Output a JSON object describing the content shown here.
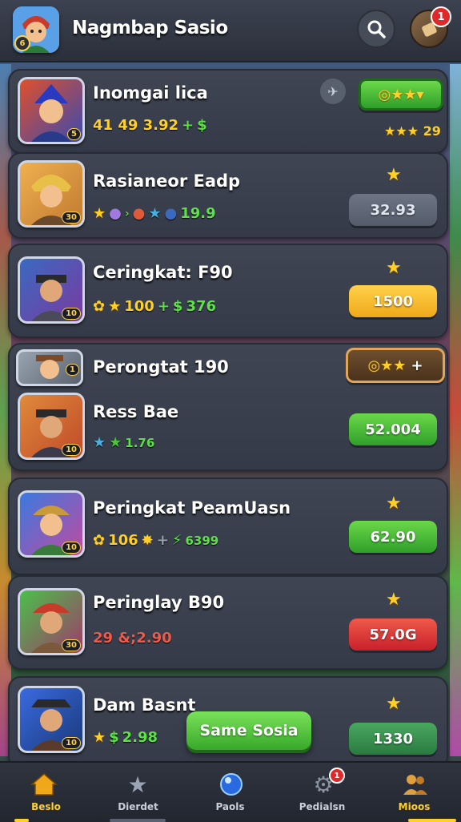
{
  "header": {
    "title": "Nagmbap Sasio",
    "avatar_badge": "6",
    "notification_count": "1"
  },
  "cards": [
    {
      "name": "Inomgai lica",
      "stat_a": "41 49 3.92",
      "stat_plus": "+",
      "stat_b": "$",
      "side_text": "29",
      "level": "5"
    },
    {
      "name": "Rasianeor Eadp",
      "stat_a": "",
      "stat_b": "19.9",
      "button": "32.93",
      "level": "30"
    },
    {
      "name": "Ceringkat: F90",
      "stat_a": "100",
      "stat_plus": "+",
      "stat_b": "376",
      "button": "1500",
      "level": "10"
    },
    {
      "name": "Perongtat 190",
      "level": "1",
      "button_plus": "+"
    },
    {
      "name": "Ress Bae",
      "stat_b": "1.76",
      "button": "52.004",
      "level": "10"
    },
    {
      "name": "Peringkat PeamUasn",
      "stat_a": "106",
      "stat_plus": "+",
      "stat_b": "6399",
      "button": "62.90",
      "level": "10"
    },
    {
      "name": "Peringlay B90",
      "stat_a": "29 &;2.90",
      "button": "57.0G",
      "level": "30"
    },
    {
      "name": "Dam Basnt",
      "stat_a": "2.98",
      "button": "1330",
      "level": "10"
    }
  ],
  "fab_label": "Same Sosia",
  "nav": [
    {
      "label": "Beslo",
      "icon": "home-icon",
      "active": true
    },
    {
      "label": "Dierdet",
      "icon": "star-icon",
      "active": false
    },
    {
      "label": "Paols",
      "icon": "orb-icon",
      "active": false
    },
    {
      "label": "Pedialsn",
      "icon": "gear-icon",
      "active": false,
      "badge": "1"
    },
    {
      "label": "Mioos",
      "icon": "people-icon",
      "active": true
    }
  ],
  "colors": {
    "accent_green": "#4ac43a",
    "accent_gold": "#ffcf2a",
    "danger": "#e02828"
  }
}
